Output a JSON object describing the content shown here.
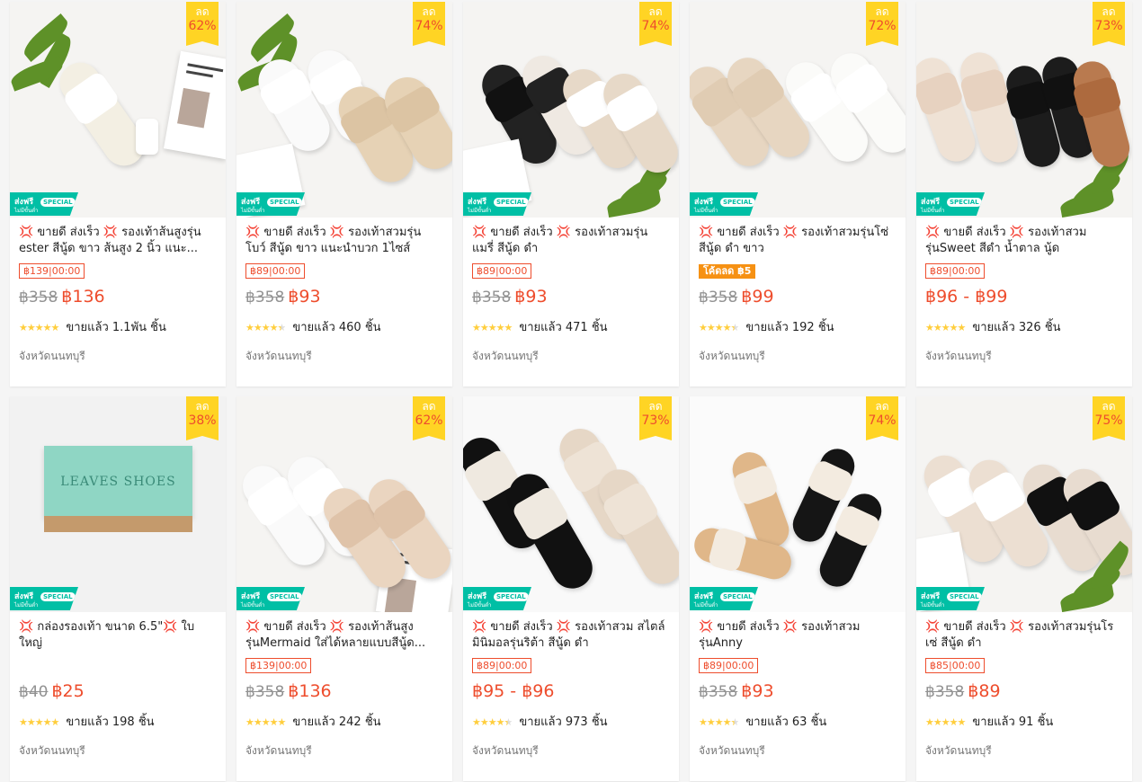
{
  "colors": {
    "accent": "#ee4d2d",
    "discount_bg": "#ffd424",
    "ship_badge": "#00bfa5",
    "coin_tag": "#f69113",
    "star": "#ffce3d"
  },
  "labels": {
    "discount": "ลด",
    "sold_prefix": "ขายแล้ว",
    "ship_main": "ส่งฟรี",
    "ship_sub": "ไม่มีขั้นต่ำ",
    "ship_special": "SPECIAL",
    "stars": "★★★★★"
  },
  "products": [
    {
      "title": "💢 ขายดี ส่งเร็ว 💢 รองเท้าส้นสูงรุ่น ester สีนู้ด ขาว ส้นสูง 2 นิ้ว แนะ...",
      "discount": "62%",
      "tag": "฿139|00:00",
      "old_price": "฿358",
      "price": "฿136",
      "rating": 5,
      "sold": "ขายแล้ว 1.1พัน ชิ้น",
      "location": "จังหวัดนนทบุรี",
      "image": "white-strappy-heel"
    },
    {
      "title": "💢 ขายดี ส่งเร็ว 💢 รองเท้าสวมรุ่น โบว์ สีนู้ด ขาว แนะนำบวก 1ไซส์",
      "discount": "74%",
      "tag": "฿89|00:00",
      "old_price": "฿358",
      "price": "฿93",
      "rating": 4.5,
      "sold": "ขายแล้ว 460 ชิ้น",
      "location": "จังหวัดนนทบุรี",
      "image": "bow-slides"
    },
    {
      "title": "💢 ขายดี ส่งเร็ว 💢 รองเท้าสวมรุ่น แมรี่ สีนู้ด ดำ",
      "discount": "74%",
      "tag": "฿89|00:00",
      "old_price": "฿358",
      "price": "฿93",
      "rating": 5,
      "sold": "ขายแล้ว 471 ชิ้น",
      "location": "จังหวัดนนทบุรี",
      "image": "colorblock-slides"
    },
    {
      "title": "💢 ขายดี ส่งเร็ว 💢 รองเท้าสวมรุ่นโซ่ สีนู้ด ดำ ขาว",
      "discount": "72%",
      "tag": "โค้ดลด ฿5",
      "tag_style": "solid",
      "old_price": "฿358",
      "price": "฿99",
      "rating": 4.5,
      "sold": "ขายแล้ว 192 ชิ้น",
      "location": "จังหวัดนนทบุรี",
      "image": "chain-slides"
    },
    {
      "title": "💢 ขายดี ส่งเร็ว 💢 รองเท้าสวม รุ่นSweet สีดำ น้ำตาล นู้ด",
      "discount": "73%",
      "tag": "฿89|00:00",
      "old_price": "",
      "price": "฿96 - ฿99",
      "rating": 5,
      "sold": "ขายแล้ว 326 ชิ้น",
      "location": "จังหวัดนนทบุรี",
      "image": "toe-loop-slides"
    },
    {
      "title": "💢 กล่องรองเท้า ขนาด 6.5\"💢 ใบ ใหญ่",
      "discount": "38%",
      "tag": "",
      "old_price": "฿40",
      "price": "฿25",
      "rating": 5,
      "sold": "ขายแล้ว 198 ชิ้น",
      "location": "จังหวัดนนทบุรี",
      "image": "shoe-box",
      "box_text": "LEAVES SHOES"
    },
    {
      "title": "💢 ขายดี ส่งเร็ว 💢 รองเท้าส้นสูง รุ่นMermaid ใส่ได้หลายแบบสีนู้ด...",
      "discount": "62%",
      "tag": "฿139|00:00",
      "old_price": "฿358",
      "price": "฿136",
      "rating": 5,
      "sold": "ขายแล้ว 242 ชิ้น",
      "location": "จังหวัดนนทบุรี",
      "image": "mermaid-heels"
    },
    {
      "title": "💢 ขายดี ส่งเร็ว 💢 รองเท้าสวม สไตล์มินิมอลรุ่นริต้า สีนู้ด ดำ",
      "discount": "73%",
      "tag": "฿89|00:00",
      "old_price": "",
      "price": "฿95 - ฿96",
      "rating": 4.5,
      "sold": "ขายแล้ว 973 ชิ้น",
      "location": "จังหวัดนนทบุรี",
      "image": "rita-slides"
    },
    {
      "title": "💢 ขายดี ส่งเร็ว 💢 รองเท้าสวม รุ่นAnny",
      "discount": "74%",
      "tag": "฿89|00:00",
      "old_price": "฿358",
      "price": "฿93",
      "rating": 4.5,
      "sold": "ขายแล้ว 63 ชิ้น",
      "location": "จังหวัดนนทบุรี",
      "image": "anny-strappy"
    },
    {
      "title": "💢 ขายดี ส่งเร็ว 💢 รองเท้าสวมรุ่นโร เซ่ สีนู้ด ดำ",
      "discount": "75%",
      "tag": "฿85|00:00",
      "old_price": "฿358",
      "price": "฿89",
      "rating": 5,
      "sold": "ขายแล้ว 91 ชิ้น",
      "location": "จังหวัดนนทบุรี",
      "image": "rose-slides"
    }
  ]
}
